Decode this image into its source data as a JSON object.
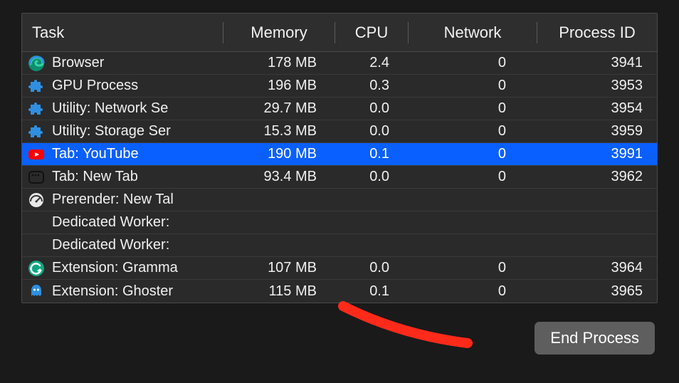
{
  "columns": {
    "task": "Task",
    "memory": "Memory",
    "cpu": "CPU",
    "network": "Network",
    "pid": "Process ID"
  },
  "rows": [
    {
      "icon": "edge",
      "task": "Browser",
      "memory": "178 MB",
      "cpu": "2.4",
      "network": "0",
      "pid": "3941",
      "selected": false
    },
    {
      "icon": "puzzle",
      "task": "GPU Process",
      "memory": "196 MB",
      "cpu": "0.3",
      "network": "0",
      "pid": "3953",
      "selected": false
    },
    {
      "icon": "puzzle",
      "task": "Utility: Network Se",
      "memory": "29.7 MB",
      "cpu": "0.0",
      "network": "0",
      "pid": "3954",
      "selected": false
    },
    {
      "icon": "puzzle",
      "task": "Utility: Storage Ser",
      "memory": "15.3 MB",
      "cpu": "0.0",
      "network": "0",
      "pid": "3959",
      "selected": false
    },
    {
      "icon": "youtube",
      "task": "Tab: YouTube",
      "memory": "190 MB",
      "cpu": "0.1",
      "network": "0",
      "pid": "3991",
      "selected": true
    },
    {
      "icon": "newtab",
      "task": "Tab: New Tab",
      "memory": "93.4 MB",
      "cpu": "0.0",
      "network": "0",
      "pid": "3962",
      "selected": false
    },
    {
      "icon": "gauge",
      "task": "Prerender: New Tal",
      "memory": "",
      "cpu": "",
      "network": "",
      "pid": "",
      "selected": false
    },
    {
      "icon": "",
      "task": "Dedicated Worker:",
      "memory": "",
      "cpu": "",
      "network": "",
      "pid": "",
      "selected": false
    },
    {
      "icon": "",
      "task": "Dedicated Worker:",
      "memory": "",
      "cpu": "",
      "network": "",
      "pid": "",
      "selected": false
    },
    {
      "icon": "grammarly",
      "task": "Extension: Gramma",
      "memory": "107 MB",
      "cpu": "0.0",
      "network": "0",
      "pid": "3964",
      "selected": false
    },
    {
      "icon": "ghostery",
      "task": "Extension: Ghoster",
      "memory": "115 MB",
      "cpu": "0.1",
      "network": "0",
      "pid": "3965",
      "selected": false
    }
  ],
  "footer": {
    "end_process": "End Process"
  }
}
